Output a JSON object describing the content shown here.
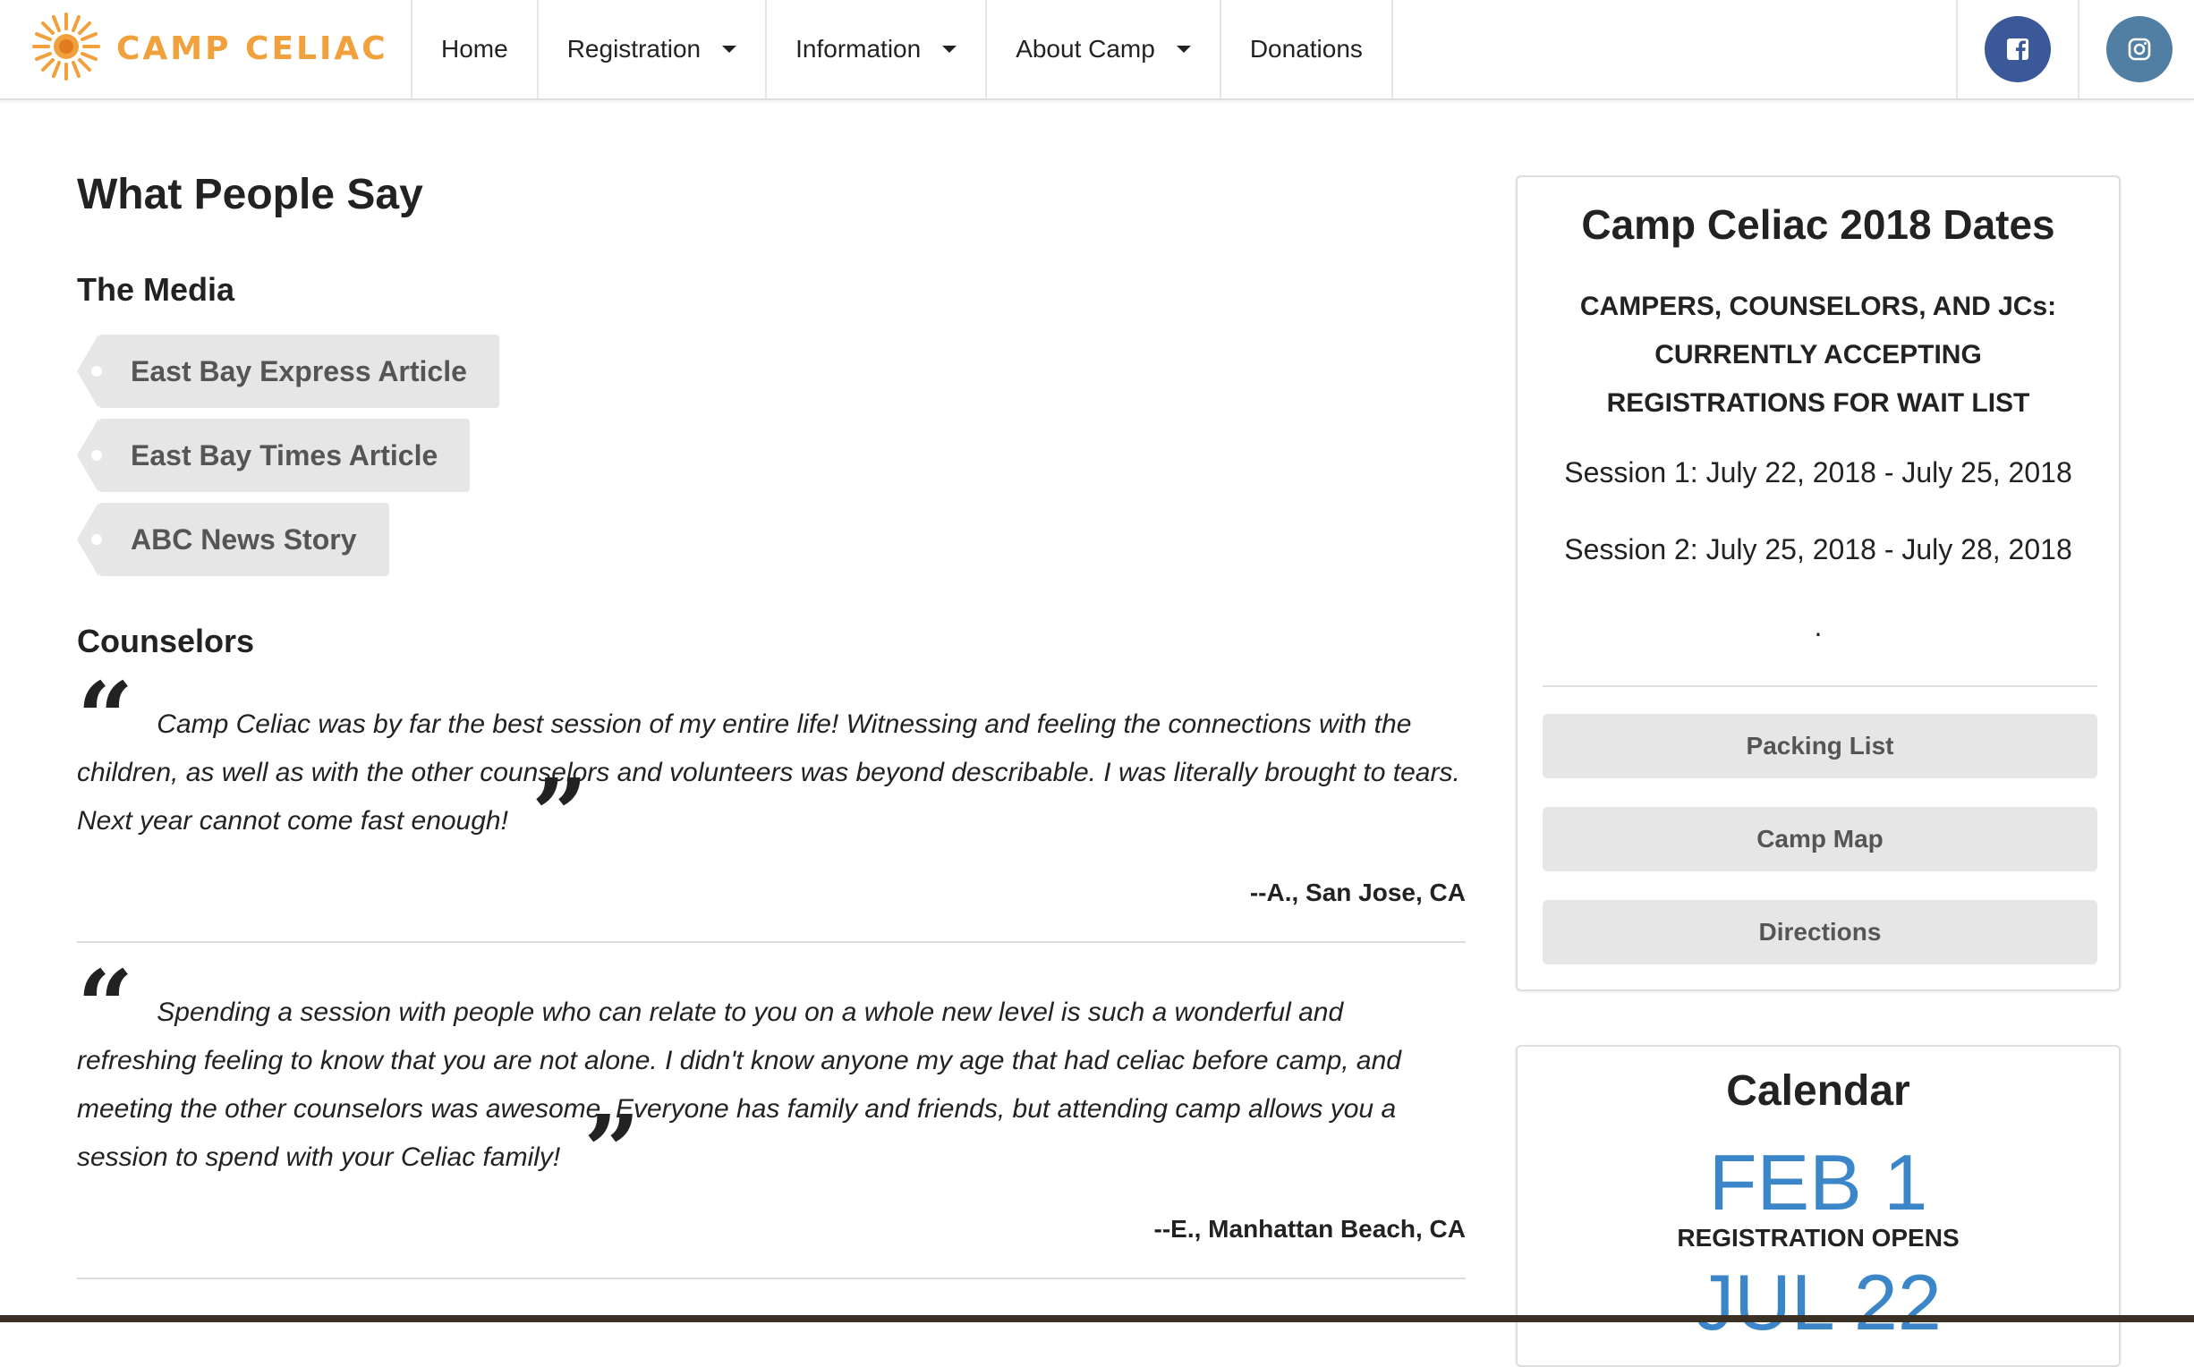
{
  "brand": {
    "name": "CAMP CELIAC",
    "logo_icon": "sun-logo-icon",
    "accent": "#f0a13c"
  },
  "nav": {
    "items": [
      {
        "label": "Home",
        "dropdown": false
      },
      {
        "label": "Registration",
        "dropdown": true
      },
      {
        "label": "Information",
        "dropdown": true
      },
      {
        "label": "About Camp",
        "dropdown": true
      },
      {
        "label": "Donations",
        "dropdown": false
      }
    ],
    "social": [
      {
        "icon": "facebook-icon",
        "color": "#3b5998"
      },
      {
        "icon": "instagram-icon",
        "color": "#517fa4"
      }
    ]
  },
  "main": {
    "title": "What People Say",
    "media_heading": "The Media",
    "media_links": [
      "East Bay Express Article",
      "East Bay Times Article",
      "ABC News Story"
    ],
    "counselors_heading": "Counselors",
    "testimonials": [
      {
        "text": "Camp Celiac was by far the best session of my entire life! Witnessing and feeling the connections with the children, as well as with the other counselors and volunteers was beyond describable. I was literally brought to tears. Next year cannot come fast enough!",
        "author": "--A., San Jose, CA"
      },
      {
        "text": "Spending a session with people who can relate to you on a whole new level is such a wonderful and refreshing feeling to know that you are not alone. I didn't know anyone my age that had celiac before camp, and meeting the other counselors was awesome. Everyone has family and friends, but attending camp allows you a session to spend with your Celiac family!",
        "author": "--E., Manhattan Beach, CA"
      }
    ]
  },
  "sidebar": {
    "dates_title": "Camp Celiac 2018 Dates",
    "notice_lines": [
      "CAMPERS, COUNSELORS, AND JCs:",
      "CURRENTLY ACCEPTING",
      "REGISTRATIONS FOR WAIT LIST"
    ],
    "sessions": [
      "Session 1: July 22, 2018 - July 25, 2018",
      "Session 2: July 25, 2018 - July 28, 2018"
    ],
    "dot": ".",
    "buttons": [
      "Packing List",
      "Camp Map",
      "Directions"
    ],
    "calendar_title": "Calendar",
    "calendar_events": [
      {
        "date": "FEB 1",
        "label": "REGISTRATION OPENS"
      },
      {
        "date": "JUL 22",
        "label": ""
      }
    ],
    "calendar_color": "#3a86c8"
  }
}
